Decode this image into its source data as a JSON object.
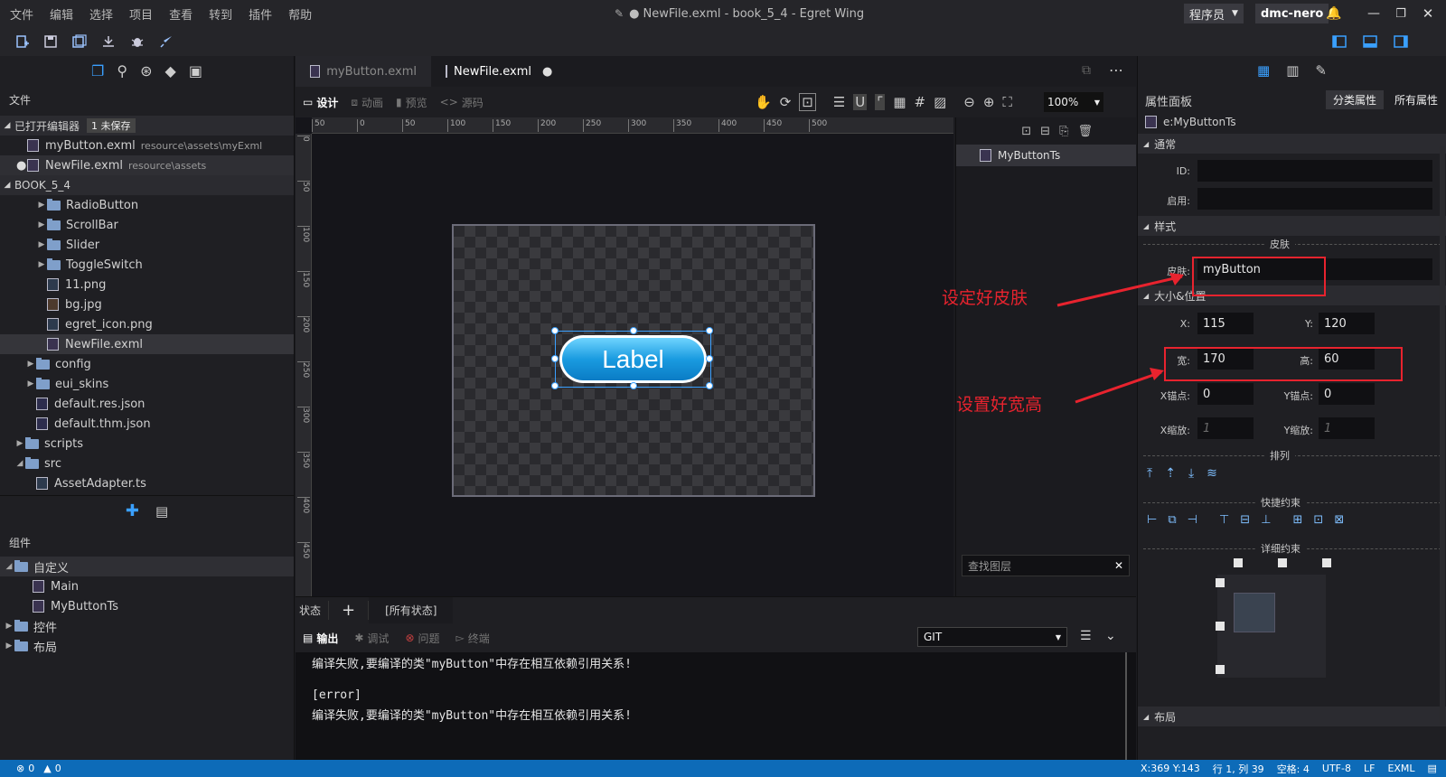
{
  "title": {
    "text": "● NewFile.exml - book_5_4 - Egret Wing",
    "role": "程序员",
    "user": "dmc-nero"
  },
  "menu": [
    "文件",
    "编辑",
    "选择",
    "项目",
    "查看",
    "转到",
    "插件",
    "帮助"
  ],
  "explorer": {
    "header": "文件",
    "open_editors": {
      "label": "已打开编辑器",
      "badge": "1 未保存"
    },
    "open_files": [
      {
        "name": "myButton.exml",
        "path": "resource\\assets\\myExml"
      },
      {
        "name": "NewFile.exml",
        "path": "resource\\assets"
      }
    ],
    "project": "BOOK_5_4",
    "tree": [
      {
        "name": "RadioButton"
      },
      {
        "name": "ScrollBar"
      },
      {
        "name": "Slider"
      },
      {
        "name": "ToggleSwitch"
      },
      {
        "name": "11.png"
      },
      {
        "name": "bg.jpg"
      },
      {
        "name": "egret_icon.png"
      },
      {
        "name": "NewFile.exml"
      },
      {
        "name": "config"
      },
      {
        "name": "eui_skins"
      },
      {
        "name": "default.res.json"
      },
      {
        "name": "default.thm.json"
      },
      {
        "name": "scripts"
      },
      {
        "name": "src"
      },
      {
        "name": "AssetAdapter.ts"
      }
    ],
    "components_header": "组件",
    "components": [
      {
        "name": "自定义"
      },
      {
        "name": "Main"
      },
      {
        "name": "MyButtonTs"
      },
      {
        "name": "控件"
      },
      {
        "name": "布局"
      }
    ]
  },
  "editor": {
    "tabs": [
      "myButton.exml",
      "NewFile.exml"
    ],
    "modes": [
      "设计",
      "动画",
      "预览",
      "源码"
    ],
    "zoom": "100%",
    "ruler_ticks": [
      "50",
      "0",
      "50",
      "100",
      "150",
      "200",
      "250",
      "300",
      "350",
      "400",
      "450",
      "500"
    ],
    "vruler_ticks": [
      "0",
      "50",
      "100",
      "150",
      "200",
      "250",
      "300",
      "350",
      "400",
      "450"
    ],
    "button_label": "Label",
    "layer_item": "MyButtonTs",
    "layer_search_placeholder": "查找图层",
    "state_label": "状态",
    "state_all": "[所有状态]"
  },
  "output": {
    "tabs": [
      "输出",
      "调试",
      "问题",
      "终端"
    ],
    "select": "GIT",
    "lines": [
      "编译失败,要编译的类\"myButton\"中存在相互依赖引用关系!",
      "",
      "[error]",
      "编译失败,要编译的类\"myButton\"中存在相互依赖引用关系!"
    ]
  },
  "props": {
    "title": "属性面板",
    "btn_category": "分类属性",
    "btn_all": "所有属性",
    "element": "e:MyButtonTs",
    "sec_common": "通常",
    "id_label": "ID:",
    "enabled_label": "启用:",
    "sec_style": "样式",
    "skin_group": "皮肤",
    "skin_label": "皮肤:",
    "skin_value": "myButton",
    "sec_size": "大小&位置",
    "x_label": "X:",
    "x_value": "115",
    "y_label": "Y:",
    "y_value": "120",
    "w_label": "宽:",
    "w_value": "170",
    "h_label": "高:",
    "h_value": "60",
    "ax_label": "X锚点:",
    "ax_value": "0",
    "ay_label": "Y锚点:",
    "ay_value": "0",
    "sx_label": "X缩放:",
    "sx_placeholder": "1",
    "sy_label": "Y缩放:",
    "sy_placeholder": "1",
    "arrange": "排列",
    "quick": "快捷约束",
    "detail": "详细约束",
    "sec_layout": "布局"
  },
  "annotations": {
    "skin": "设定好皮肤",
    "size": "设置好宽高"
  },
  "status": {
    "errors": "0",
    "warnings": "0",
    "cursor": "X:369 Y:143",
    "line": "行 1, 列 39",
    "spaces": "空格: 4",
    "encoding": "UTF-8",
    "eol": "LF",
    "lang": "EXML"
  },
  "colors": {
    "accent": "#0d6bb8",
    "annotation": "#e8232e"
  }
}
